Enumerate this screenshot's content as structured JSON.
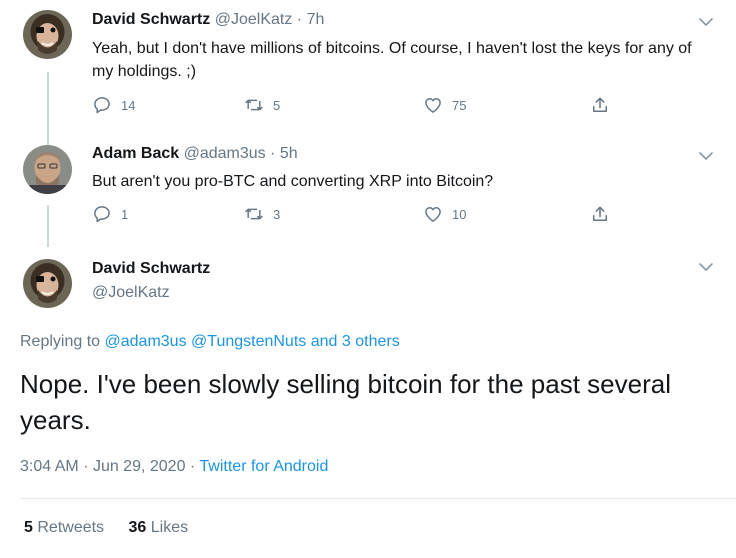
{
  "tweets": [
    {
      "name": "David Schwartz",
      "handle": "@JoelKatz",
      "sep": "·",
      "time": "7h",
      "text": "Yeah, but I don't have millions of bitcoins. Of course, I haven't lost the keys for any of my holdings. ;)",
      "replies": "14",
      "retweets": "5",
      "likes": "75"
    },
    {
      "name": "Adam Back",
      "handle": "@adam3us",
      "sep": "·",
      "time": "5h",
      "text": "But aren't you pro-BTC and converting XRP into Bitcoin?",
      "replies": "1",
      "retweets": "3",
      "likes": "10"
    }
  ],
  "main": {
    "name": "David Schwartz",
    "handle": "@JoelKatz",
    "replying_prefix": "Replying to",
    "replying_users": [
      "@adam3us",
      "@TungstenNuts"
    ],
    "replying_and": "and",
    "replying_others": "3 others",
    "text": "Nope. I've been slowly selling bitcoin for the past several years.",
    "time": "3:04 AM",
    "sep": "·",
    "date": "Jun 29, 2020",
    "source": "Twitter for Android",
    "retweets_count": "5",
    "retweets_label": "Retweets",
    "likes_count": "36",
    "likes_label": "Likes"
  },
  "icons": {
    "reply": "reply-icon",
    "retweet": "retweet-icon",
    "like": "heart-icon",
    "share": "share-icon",
    "more": "chevron-down-icon"
  },
  "colors": {
    "link": "#1b95e0",
    "muted": "#657786",
    "text": "#14171a",
    "thread_line": "#ccd6dd",
    "divider": "#e6ecf0"
  }
}
